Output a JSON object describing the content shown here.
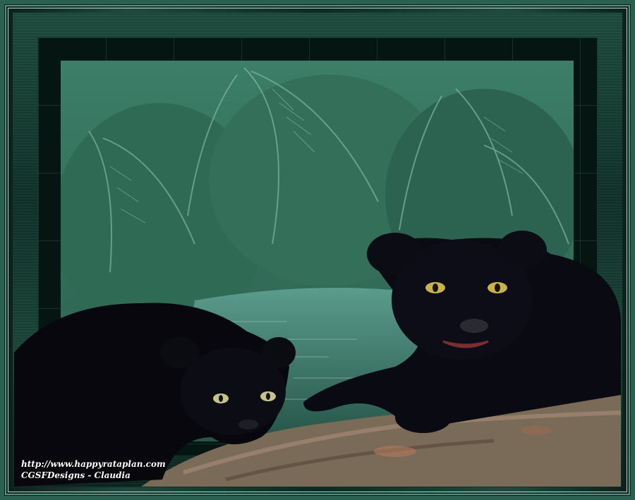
{
  "watermark": {
    "url": "http://www.happyrataplan.com",
    "credit": "CGSFDesigns - Claudia"
  },
  "scene": {
    "subject": "two-black-panther-cubs",
    "setting": "jungle-river",
    "colors": {
      "frame_green": "#1d4a3c",
      "mat_dark": "#051511",
      "jungle": "#2e6b58",
      "water": "#3e7f70",
      "fur": "#0a0a12",
      "eyes": "#c9b24a",
      "log": "#7a6a58"
    }
  }
}
